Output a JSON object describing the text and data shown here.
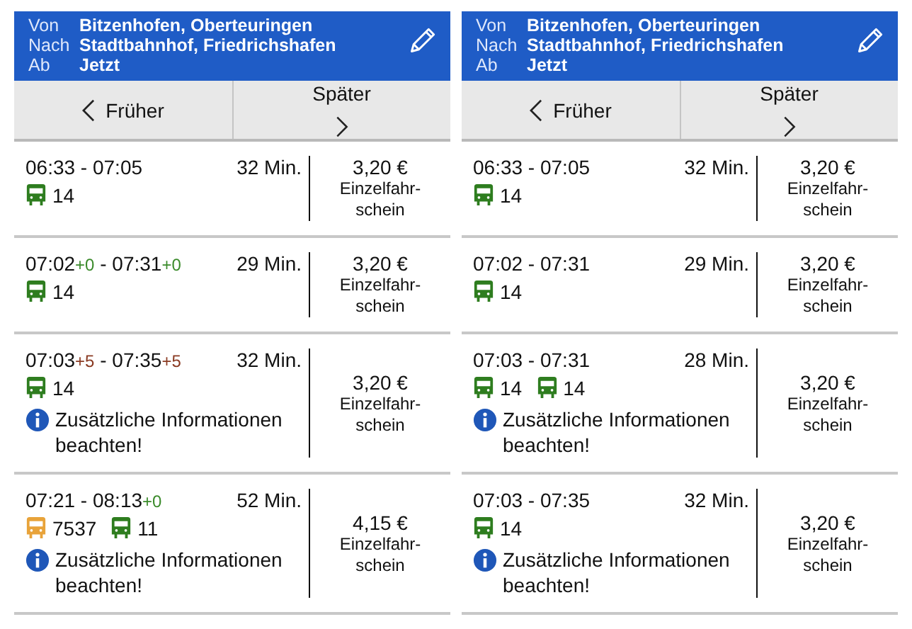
{
  "panels": [
    {
      "header": {
        "from_label": "Von",
        "from": "Bitzenhofen, Oberteuringen",
        "to_label": "Nach",
        "to": "Stadtbahnhof, Friedrichshafen",
        "dep_label": "Ab",
        "dep": "Jetzt"
      },
      "nav": {
        "earlier": "Früher",
        "later": "Später"
      },
      "connections": [
        {
          "dep": "06:33",
          "sep": "-",
          "arr": "07:05",
          "duration": "32 Min.",
          "legs": [
            {
              "line": "14",
              "color": "#2e7d1f"
            }
          ],
          "price": "3,20 €",
          "ticket": "Einzelfahr-\nschein"
        },
        {
          "dep": "07:02",
          "dep_delay": {
            "text": "+0",
            "kind": "on_time"
          },
          "sep": "-",
          "arr": "07:31",
          "arr_delay": {
            "text": "+0",
            "kind": "on_time"
          },
          "duration": "29 Min.",
          "legs": [
            {
              "line": "14",
              "color": "#2e7d1f"
            }
          ],
          "price": "3,20 €",
          "ticket": "Einzelfahr-\nschein"
        },
        {
          "dep": "07:03",
          "dep_delay": {
            "text": "+5",
            "kind": "late"
          },
          "sep": "-",
          "arr": "07:35",
          "arr_delay": {
            "text": "+5",
            "kind": "late"
          },
          "duration": "32 Min.",
          "legs": [
            {
              "line": "14",
              "color": "#2e7d1f"
            }
          ],
          "info": "Zusätzliche Informationen beachten!",
          "price": "3,20 €",
          "ticket": "Einzelfahr-\nschein"
        },
        {
          "dep": "07:21",
          "sep": "-",
          "arr": "08:13",
          "arr_delay": {
            "text": "+0",
            "kind": "on_time"
          },
          "duration": "52 Min.",
          "legs": [
            {
              "line": "7537",
              "color": "#e8a33a"
            },
            {
              "line": "11",
              "color": "#2e7d1f"
            }
          ],
          "info": "Zusätzliche Informationen beachten!",
          "price": "4,15 €",
          "ticket": "Einzelfahr-\nschein"
        }
      ]
    },
    {
      "header": {
        "from_label": "Von",
        "from": "Bitzenhofen, Oberteuringen",
        "to_label": "Nach",
        "to": "Stadtbahnhof, Friedrichshafen",
        "dep_label": "Ab",
        "dep": "Jetzt"
      },
      "nav": {
        "earlier": "Früher",
        "later": "Später"
      },
      "connections": [
        {
          "dep": "06:33",
          "sep": "-",
          "arr": "07:05",
          "duration": "32 Min.",
          "legs": [
            {
              "line": "14",
              "color": "#2e7d1f"
            }
          ],
          "price": "3,20 €",
          "ticket": "Einzelfahr-\nschein"
        },
        {
          "dep": "07:02",
          "sep": "-",
          "arr": "07:31",
          "duration": "29 Min.",
          "legs": [
            {
              "line": "14",
              "color": "#2e7d1f"
            }
          ],
          "price": "3,20 €",
          "ticket": "Einzelfahr-\nschein"
        },
        {
          "dep": "07:03",
          "sep": "-",
          "arr": "07:31",
          "duration": "28 Min.",
          "legs": [
            {
              "line": "14",
              "color": "#2e7d1f"
            },
            {
              "line": "14",
              "color": "#2e7d1f"
            }
          ],
          "info": "Zusätzliche Informationen beachten!",
          "price": "3,20 €",
          "ticket": "Einzelfahr-\nschein"
        },
        {
          "dep": "07:03",
          "sep": "-",
          "arr": "07:35",
          "duration": "32 Min.",
          "legs": [
            {
              "line": "14",
              "color": "#2e7d1f"
            }
          ],
          "info": "Zusätzliche Informationen beachten!",
          "price": "3,20 €",
          "ticket": "Einzelfahr-\nschein"
        }
      ]
    }
  ]
}
